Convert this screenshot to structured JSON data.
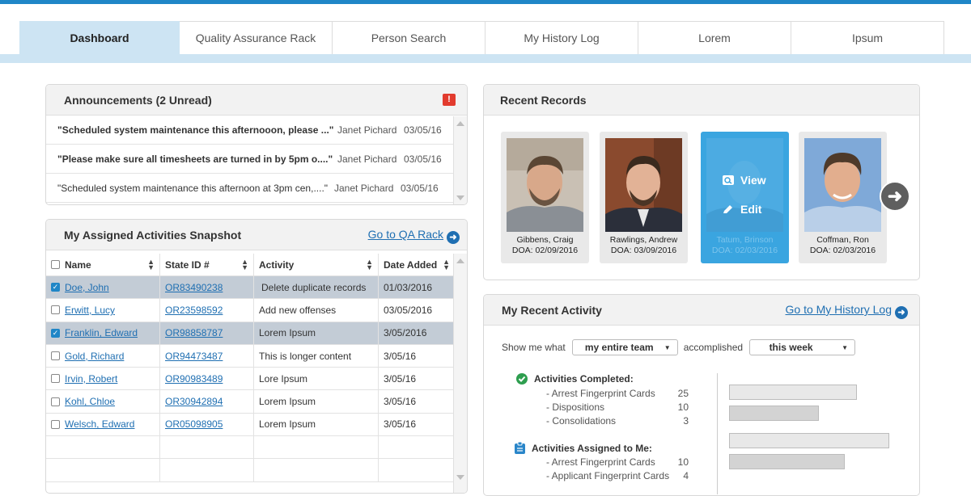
{
  "tabs": [
    "Dashboard",
    "Quality Assurance Rack",
    "Person Search",
    "My History Log",
    "Lorem",
    "Ipsum"
  ],
  "announcements": {
    "title": "Announcements (2 Unread)",
    "items": [
      {
        "message": "\"Scheduled system maintenance this afternooon, please ...\"",
        "author": "Janet Pichard",
        "date": "03/05/16",
        "unread": true
      },
      {
        "message": "\"Please make sure all timesheets are turned in by 5pm o....\"",
        "author": "Janet Pichard",
        "date": "03/05/16",
        "unread": true
      },
      {
        "message": "\"Scheduled system maintenance this afternoon at 3pm cen,....\"",
        "author": "Janet Pichard",
        "date": "03/05/16",
        "unread": false
      }
    ]
  },
  "activities": {
    "title": "My Assigned Activities Snapshot",
    "link": "Go to QA Rack",
    "columns": [
      "Name",
      "State ID #",
      "Activity",
      "Date Added"
    ],
    "rows": [
      {
        "name": "Doe, John",
        "state_id": "OR83490238",
        "activity": "Delete duplicate records",
        "date": "01/03/2016",
        "checked": true
      },
      {
        "name": "Erwitt, Lucy",
        "state_id": "OR23598592",
        "activity": "Add new offenses",
        "date": "03/05/2016",
        "checked": false
      },
      {
        "name": "Franklin, Edward",
        "state_id": "OR98858787",
        "activity": "Lorem Ipsum",
        "date": "3/05/2016",
        "checked": true
      },
      {
        "name": "Gold, Richard",
        "state_id": "OR94473487",
        "activity": "This is longer content",
        "date": "3/05/16",
        "checked": false
      },
      {
        "name": "Irvin, Robert",
        "state_id": "OR90983489",
        "activity": "Lore Ipsum",
        "date": "3/05/16",
        "checked": false
      },
      {
        "name": "Kohl, Chloe",
        "state_id": "OR30942894",
        "activity": "Lorem Ipsum",
        "date": "3/05/16",
        "checked": false
      },
      {
        "name": "Welsch, Edward",
        "state_id": "OR05098905",
        "activity": "Lorem Ipsum",
        "date": "3/05/16",
        "checked": false
      }
    ]
  },
  "records": {
    "title": "Recent Records",
    "cards": [
      {
        "name": "Gibbens, Craig",
        "doa": "DOA: 02/09/2016"
      },
      {
        "name": "Rawlings, Andrew",
        "doa": "DOA: 03/09/2016"
      },
      {
        "name": "Tatum, Brinson",
        "doa": "DOA: 02/03/2016"
      },
      {
        "name": "Coffman, Ron",
        "doa": "DOA: 02/03/2016"
      }
    ],
    "view_label": "View",
    "edit_label": "Edit"
  },
  "recent_activity": {
    "title": "My Recent Activity",
    "link": "Go to My History Log",
    "show_prefix": "Show me what",
    "who_select": "my entire team",
    "mid_text": "accomplished",
    "when_select": "this week",
    "completed": {
      "heading": "Activities Completed:",
      "items": [
        {
          "label": "- Arrest Fingerprint Cards",
          "count": "25",
          "value": 25
        },
        {
          "label": "- Dispositions",
          "count": "10",
          "value": 10
        },
        {
          "label": "- Consolidations",
          "count": "3",
          "value": 3
        }
      ]
    },
    "assigned": {
      "heading": "Activities Assigned to Me:",
      "items": [
        {
          "label": "- Arrest Fingerprint Cards",
          "count": "10",
          "value": 10
        },
        {
          "label": "- Applicant Fingerprint Cards",
          "count": "4",
          "value": 4
        }
      ]
    },
    "colors": {
      "check": "#2e9e4f",
      "clipboard": "#2a86c9"
    }
  },
  "colors": {
    "accent": "#1f86c7",
    "tab_active": "#cde4f3",
    "selected_row": "#c3ccd6",
    "link": "#1f6fb2",
    "alert": "#e23b2e"
  }
}
